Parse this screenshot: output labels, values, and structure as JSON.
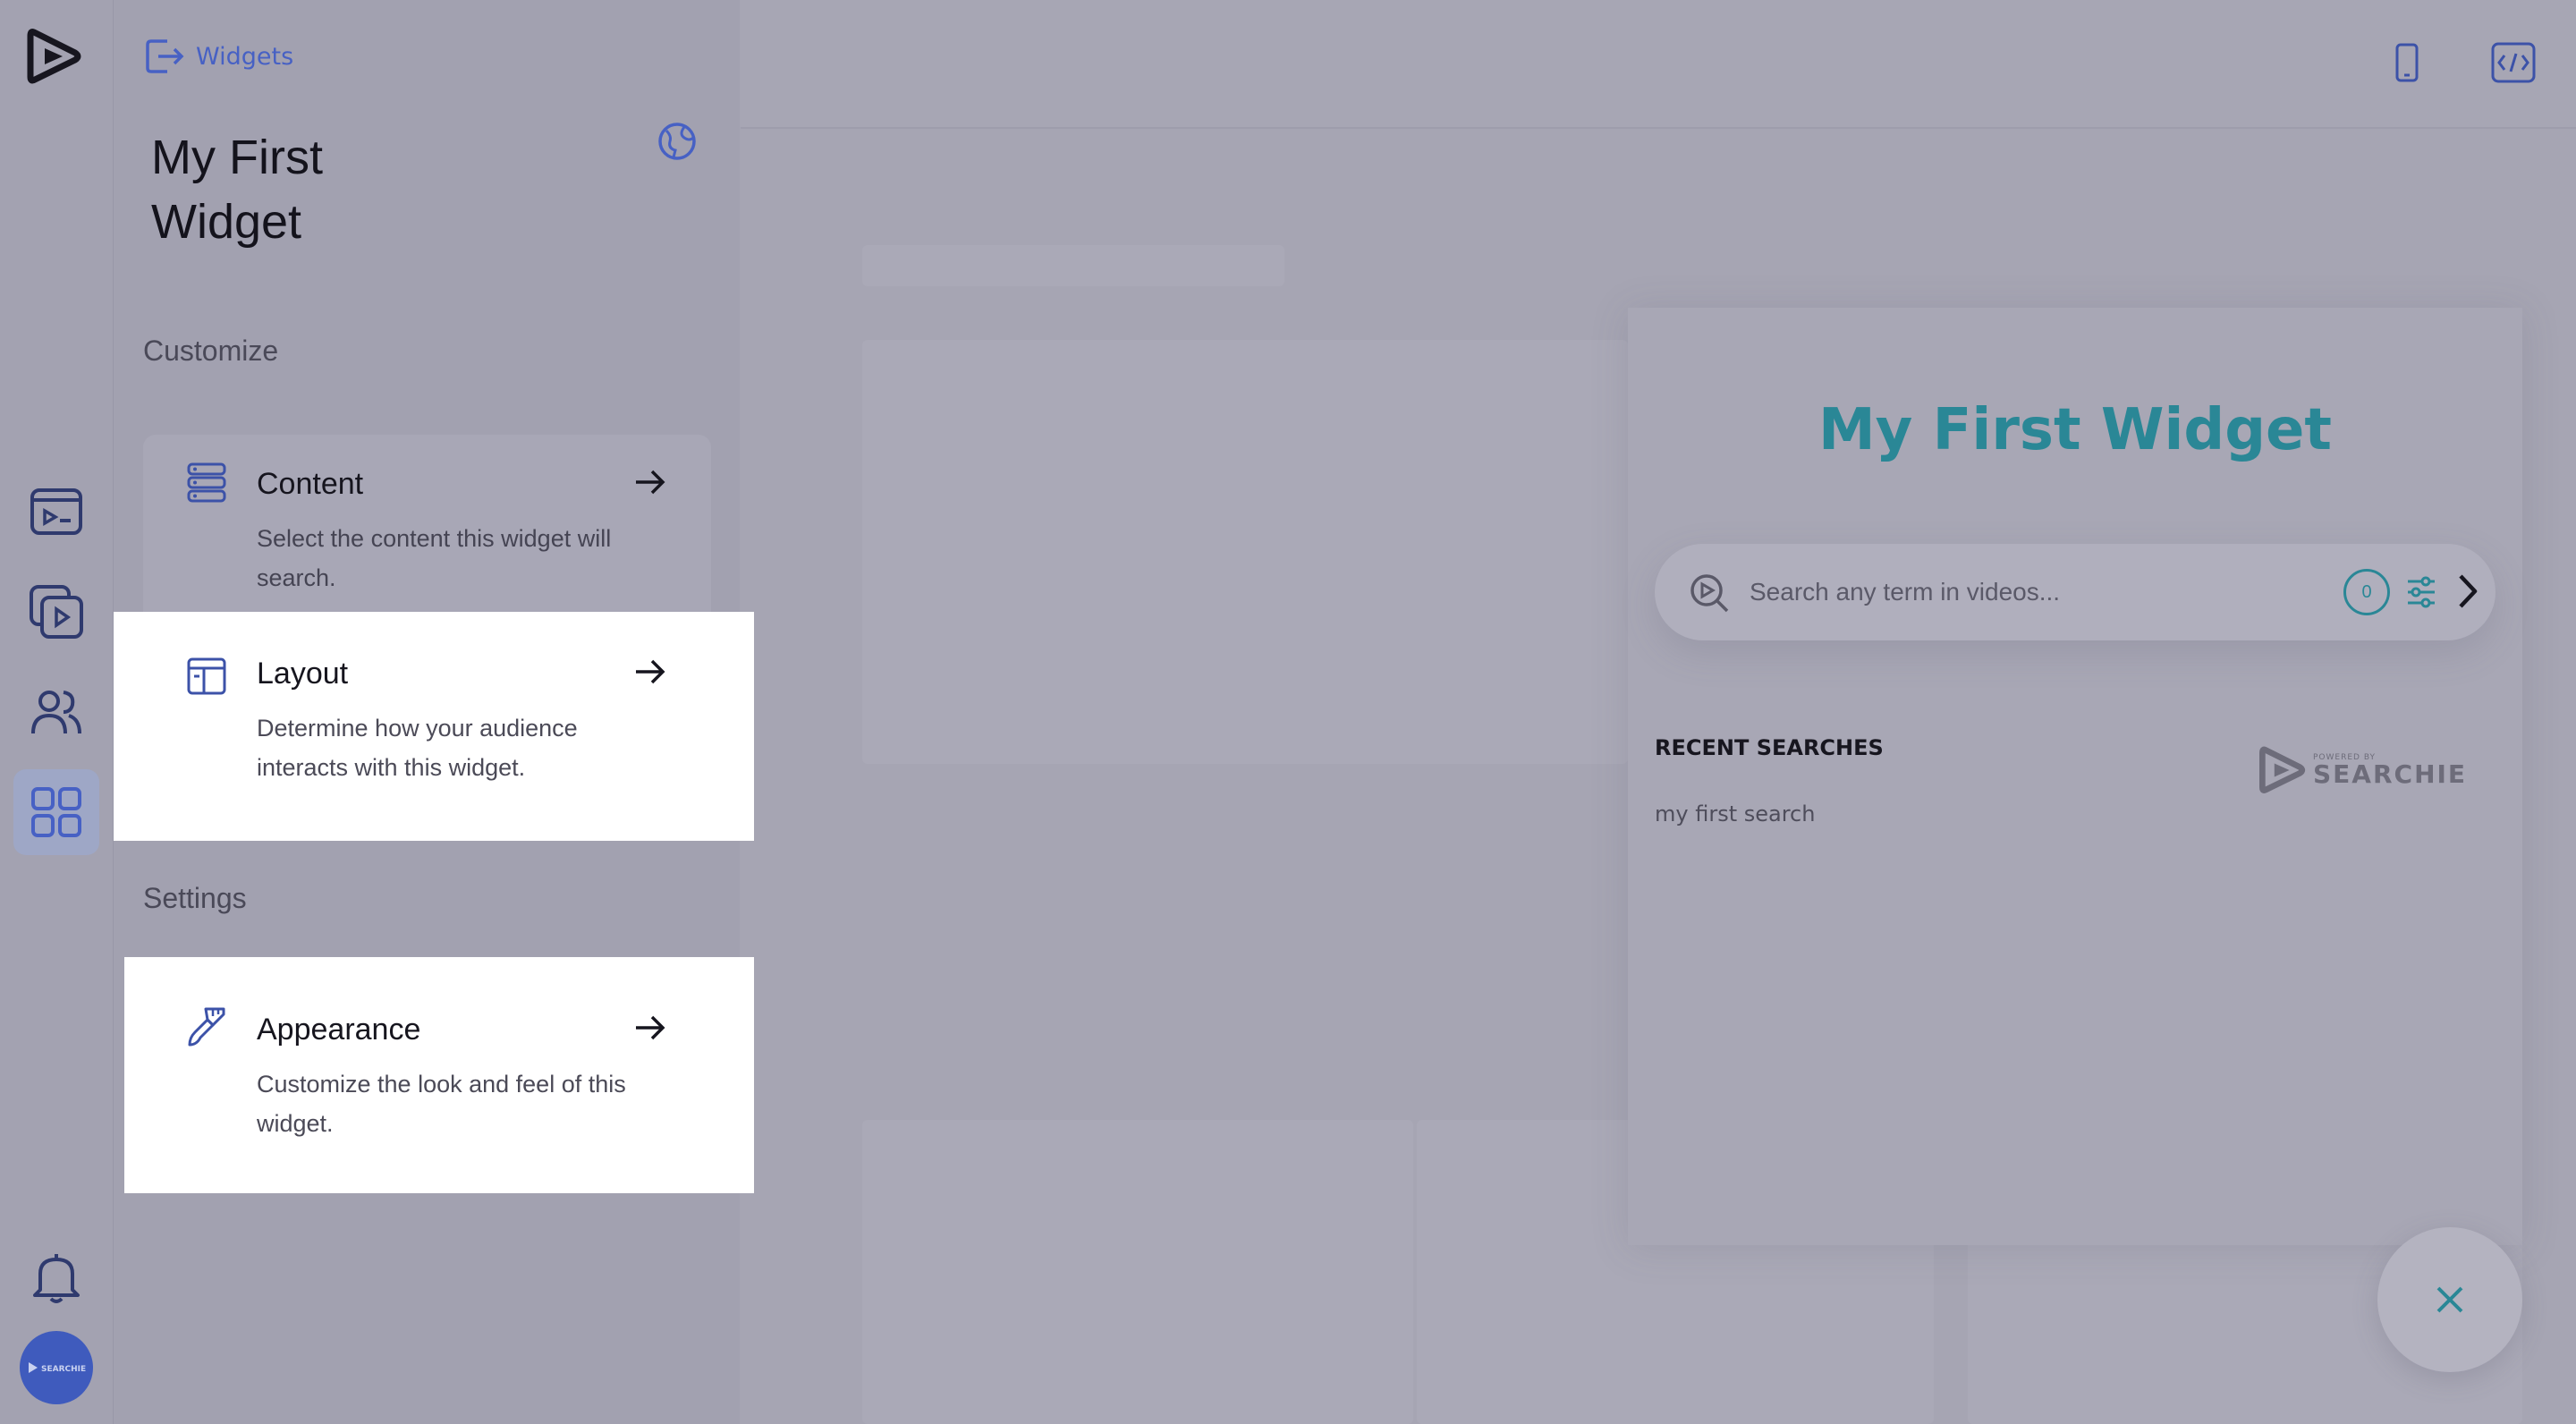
{
  "sidebar": {
    "back_label": "Widgets",
    "title": "My First Widget",
    "sections": {
      "customize": "Customize",
      "settings": "Settings"
    },
    "cards": [
      {
        "title": "Content",
        "description": "Select the content this widget will search."
      },
      {
        "title": "Layout",
        "description": "Determine how your audience interacts with this widget."
      },
      {
        "title": "Appearance",
        "description": "Customize the look and feel of this widget."
      }
    ]
  },
  "rail": {
    "avatar_text": "SEARCHIE"
  },
  "preview": {
    "widget_title": "My First Widget",
    "search_placeholder": "Search any term in videos...",
    "filter_count": "0",
    "recent_heading": "RECENT SEARCHES",
    "recent_items": [
      "my first search"
    ],
    "powered_small": "POWERED BY",
    "powered_brand": "SEARCHIE"
  },
  "colors": {
    "accent": "#4761c4",
    "widget_title": "#2a8796"
  }
}
